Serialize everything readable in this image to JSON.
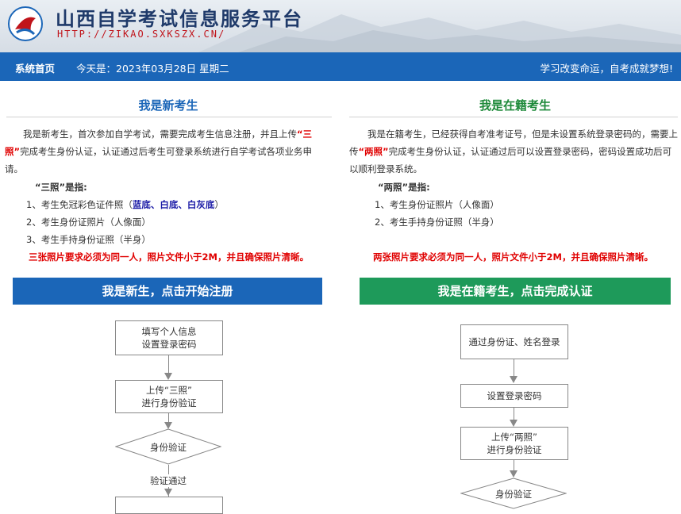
{
  "header": {
    "title": "山西自学考试信息服务平台",
    "url": "HTTP://ZIKAO.SXKSZX.CN/"
  },
  "nav": {
    "home": "系统首页",
    "date": "今天是：2023年03月28日   星期二",
    "slogan": "学习改变命运，自考成就梦想!"
  },
  "left": {
    "title": "我是新考生",
    "intro_p1": "我是新考生，首次参加自学考试，需要完成考生信息注册，并且上传",
    "intro_red": "“三照”",
    "intro_p2": "完成考生身份认证，认证通过后考生可登录系统进行自学考试各项业务申请。",
    "def_label": "“三照”是指:",
    "item1_pre": "1、考生免冠彩色证件照（",
    "item1_blue": "蓝底、白底、白灰底",
    "item1_post": "）",
    "item2": "2、考生身份证照片（人像面）",
    "item3": "3、考生手持身份证照（半身）",
    "warning": "三张照片要求必须为同一人，照片文件小于2M，并且确保照片清晰。",
    "cta": "我是新生，点击开始注册",
    "flow": {
      "step1_l1": "填写个人信息",
      "step1_l2": "设置登录密码",
      "step2_l1": "上传“三照”",
      "step2_l2": "进行身份验证",
      "verify": "身份验证",
      "passed": "验证通过"
    }
  },
  "right": {
    "title": "我是在籍考生",
    "intro": "我是在籍考生，已经获得自考准考证号，但是未设置系统登录密码的，需要上传",
    "intro_red": "“两照”",
    "intro_p2": "完成考生身份认证，认证通过后可以设置登录密码，密码设置成功后可以顺利登录系统。",
    "def_label": "“两照”是指:",
    "item1": "1、考生身份证照片（人像面）",
    "item2": "2、考生手持身份证照（半身）",
    "warning": "两张照片要求必须为同一人，照片文件小于2M，并且确保照片清晰。",
    "cta": "我是在籍考生，点击完成认证",
    "flow": {
      "step1": "通过身份证、姓名登录",
      "step2": "设置登录密码",
      "step3_l1": "上传“两照”",
      "step3_l2": "进行身份验证",
      "verify": "身份验证"
    }
  },
  "colors": {
    "nav_blue": "#1b66b8",
    "left_title": "#1b66b8",
    "right_title": "#1e8a3a",
    "cta_green": "#1e9a5a",
    "warning_red": "#e00000"
  }
}
